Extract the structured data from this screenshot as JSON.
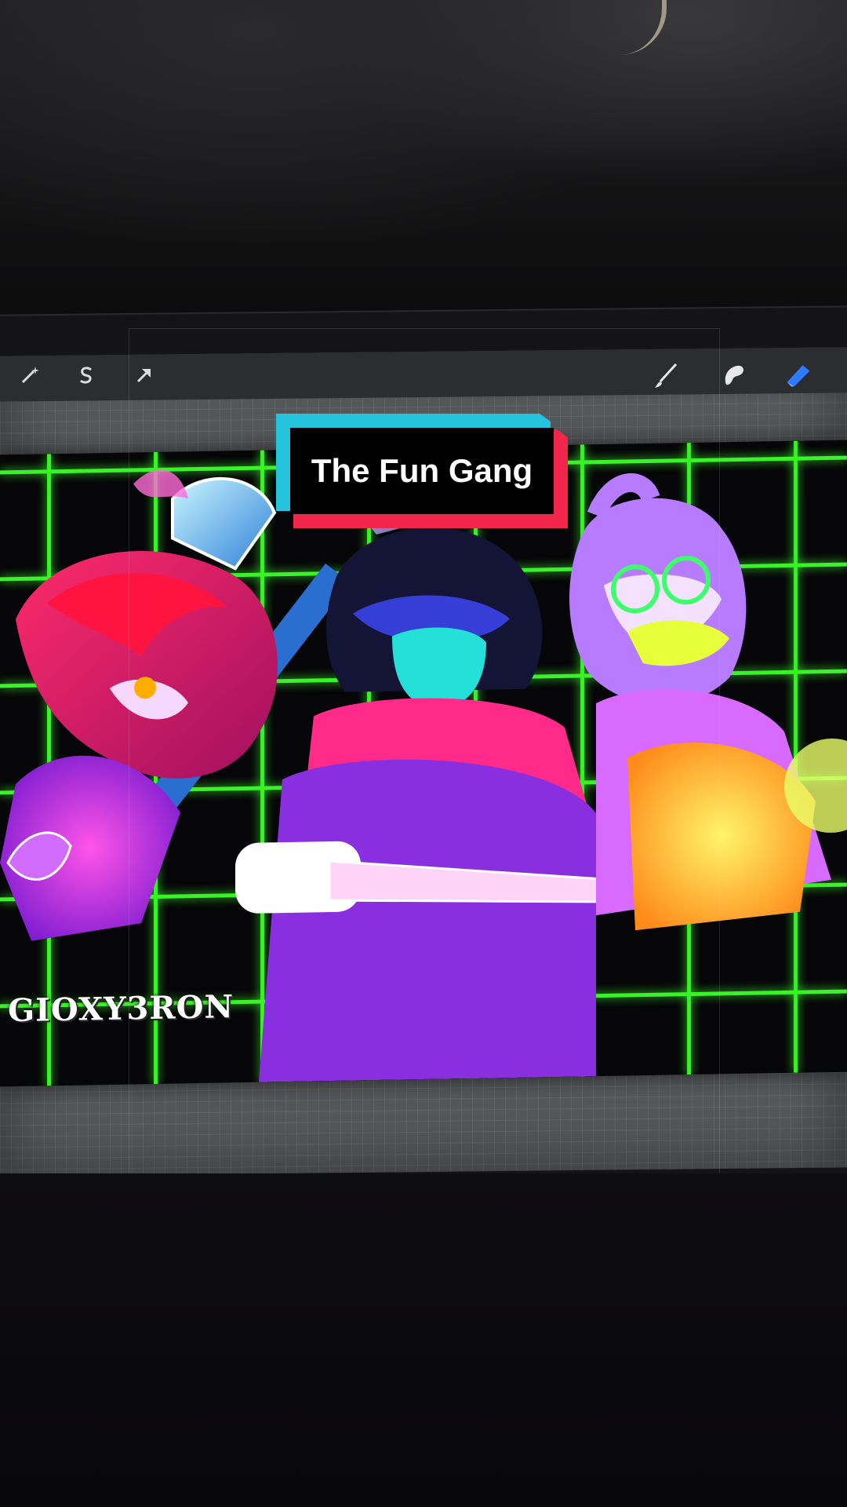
{
  "caption": {
    "text": "The Fun Gang"
  },
  "toolbar": {
    "left_tools": [
      "adjustments-wand-icon",
      "selection-s-icon",
      "transform-arrow-icon"
    ],
    "right_tools": [
      "brush-icon",
      "smudge-icon",
      "eraser-icon"
    ],
    "active_tool": "eraser-icon"
  },
  "artwork": {
    "signature": "GIOXY3RON"
  },
  "colors": {
    "grid": "#3dff2a",
    "caption_cyan": "#25c4dd",
    "caption_red": "#f2264a",
    "active_tool": "#2f7bff"
  }
}
